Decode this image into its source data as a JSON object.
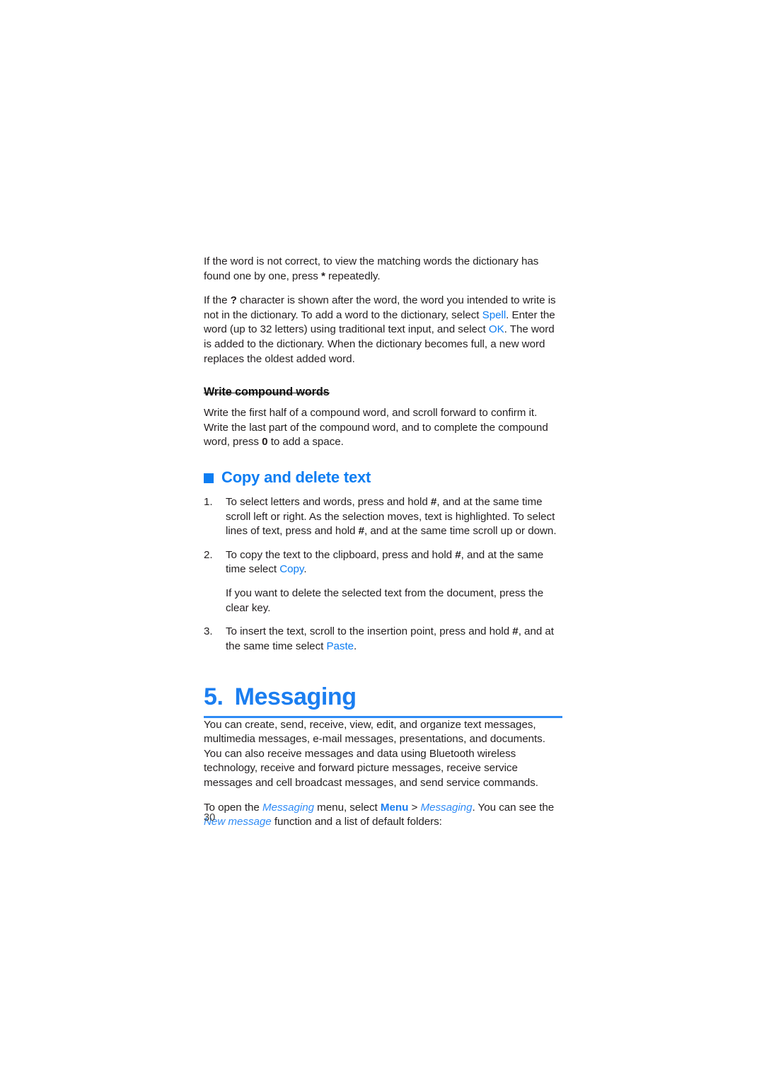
{
  "document": {
    "page_number": "30"
  },
  "colors": {
    "accent_blue": "#0d7df2",
    "heading_blue": "#1b7ef0",
    "rule_blue": "#2f8bf5",
    "body_black": "#231f20"
  },
  "content": {
    "para_1": {
      "text_a": "If the word is not correct, to view the matching words the dictionary has found one by one, press ",
      "key": "*",
      "text_b": " repeatedly."
    },
    "para_2": {
      "text_a": "If the ",
      "key_q": "?",
      "text_b": " character is shown after the word, the word you intended to write is not in the dictionary. To add a word to the dictionary, select ",
      "link_spell": "Spell",
      "text_c": ". Enter the word (up to 32 letters) using traditional text input, and select ",
      "link_ok": "OK",
      "text_d": ". The word is added to the dictionary. When the dictionary becomes full, a new word replaces the oldest added word."
    },
    "subheading_compound": "Write compound words",
    "para_3": {
      "text_a": "Write the first half of a compound word, and scroll forward to confirm it. Write the last part of the compound word, and to complete the compound word, press ",
      "key_zero": "0",
      "text_b": " to add a space."
    },
    "section_copy_delete": {
      "bullet_icon": "square-bullet-icon",
      "title": "Copy and delete text"
    },
    "steps": [
      {
        "number": "1.",
        "text_a": "To select letters and words, press and hold ",
        "key_1": "#",
        "text_b": ", and at the same time scroll left or right. As the selection moves, text is highlighted. To select lines of text, press and hold ",
        "key_2": "#",
        "text_c": ", and at the same time scroll up or down."
      },
      {
        "number": "2.",
        "text_a": "To copy the text to the clipboard, press and hold ",
        "key_1": "#",
        "text_b": ", and at the same time select ",
        "link": "Copy",
        "text_c": ".",
        "sub_para": "If you want to delete the selected text from the document, press the clear key."
      },
      {
        "number": "3.",
        "text_a": "To insert the text, scroll to the insertion point, press and hold ",
        "key_1": "#",
        "text_b": ", and at the same time select ",
        "link": "Paste",
        "text_c": "."
      }
    ],
    "chapter": {
      "number": "5.",
      "title": "Messaging"
    },
    "para_4": "You can create, send, receive, view, edit, and organize text messages, multimedia messages, e-mail messages, presentations, and documents. You can also receive messages and data using Bluetooth wireless technology, receive and forward picture messages, receive service messages and cell broadcast messages, and send service commands.",
    "para_5": {
      "text_a": "To open the ",
      "italic_1": "Messaging",
      "text_b": " menu, select ",
      "menu": "Menu",
      "text_c": " > ",
      "italic_2": "Messaging",
      "text_d": ". You can see the ",
      "italic_3": "New message",
      "text_e": " function and a list of default folders:"
    }
  }
}
